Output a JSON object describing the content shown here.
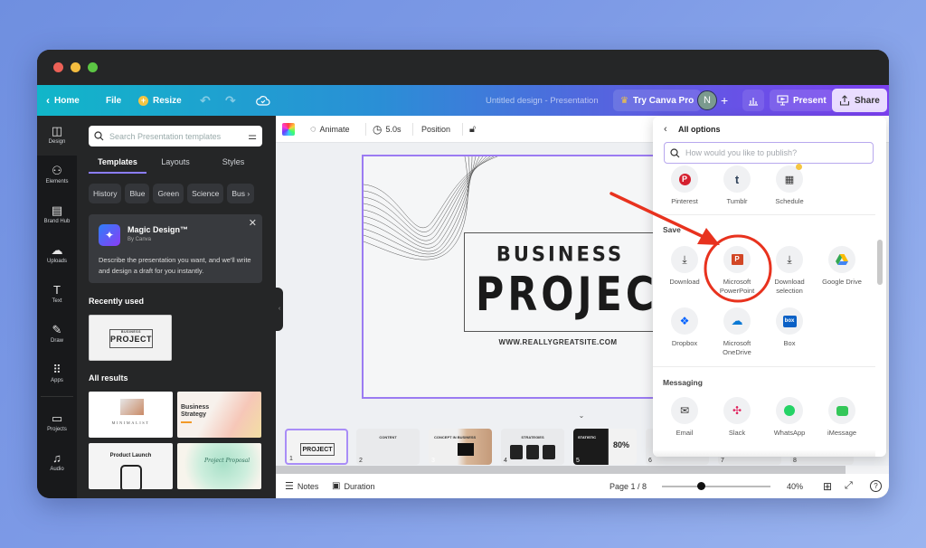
{
  "window": {
    "topbar": {
      "home": "Home",
      "file": "File",
      "resize": "Resize",
      "doc_title": "Untitled design - Presentation",
      "try_pro": "Try Canva Pro",
      "avatar_initial": "N",
      "present": "Present",
      "share": "Share"
    },
    "leftnav": [
      {
        "label": "Design",
        "icon": "layout-icon"
      },
      {
        "label": "Elements",
        "icon": "shapes-icon"
      },
      {
        "label": "Brand Hub",
        "icon": "briefcase-icon"
      },
      {
        "label": "Uploads",
        "icon": "cloud-upload-icon"
      },
      {
        "label": "Text",
        "icon": "text-icon"
      },
      {
        "label": "Draw",
        "icon": "pen-icon"
      },
      {
        "label": "Apps",
        "icon": "grid-icon"
      },
      {
        "label": "Projects",
        "icon": "folder-icon"
      },
      {
        "label": "Audio",
        "icon": "music-icon"
      }
    ],
    "panel": {
      "search_placeholder": "Search Presentation templates",
      "tabs": [
        "Templates",
        "Layouts",
        "Styles"
      ],
      "chips": [
        "History",
        "Blue",
        "Green",
        "Science",
        "Bus"
      ],
      "magic": {
        "title": "Magic Design™",
        "by": "By Canva",
        "desc": "Describe the presentation you want, and we'll write and design a draft for you instantly."
      },
      "recently_used": "Recently used",
      "recent_thumb": {
        "small": "BUSINESS",
        "big": "PROJECT"
      },
      "all_results": "All results",
      "results": [
        {
          "title": "MINIMALIST"
        },
        {
          "title": "Business Strategy"
        },
        {
          "title": "Product Launch"
        },
        {
          "title": "Project Proposal"
        }
      ]
    },
    "toolbar": {
      "animate": "Animate",
      "duration": "5.0s",
      "position": "Position"
    },
    "slide": {
      "line1": "BUSINESS",
      "line2": "PROJECT",
      "url": "WWW.REALLYGREATSITE.COM"
    },
    "pages": [
      {
        "num": "1",
        "title": "BUSINESS",
        "big": "PROJECT"
      },
      {
        "num": "2",
        "title": "CONTENT"
      },
      {
        "num": "3",
        "title": "CONCEPT IN BUSINESS"
      },
      {
        "num": "4",
        "title": "STRATEGIES"
      },
      {
        "num": "5",
        "title": "STATISTIC",
        "big": "80%"
      },
      {
        "num": "6"
      },
      {
        "num": "7"
      },
      {
        "num": "8"
      }
    ],
    "bottombar": {
      "notes": "Notes",
      "duration": "Duration",
      "page": "Page 1 / 8",
      "zoom": "40%",
      "zoom_value": 40
    },
    "share_panel": {
      "title": "All options",
      "search_placeholder": "How would you like to publish?",
      "social": [
        {
          "label": "Pinterest",
          "icon": "pinterest-icon"
        },
        {
          "label": "Tumblr",
          "icon": "tumblr-icon"
        },
        {
          "label": "Schedule",
          "icon": "calendar-icon"
        }
      ],
      "save_heading": "Save",
      "save": [
        {
          "label": "Download",
          "icon": "download-icon"
        },
        {
          "label": "Microsoft PowerPoint",
          "icon": "powerpoint-icon"
        },
        {
          "label": "Download selection",
          "icon": "download-icon"
        },
        {
          "label": "Google Drive",
          "icon": "google-drive-icon"
        },
        {
          "label": "Dropbox",
          "icon": "dropbox-icon"
        },
        {
          "label": "Microsoft OneDrive",
          "icon": "onedrive-icon"
        },
        {
          "label": "Box",
          "icon": "box-icon"
        }
      ],
      "messaging_heading": "Messaging",
      "messaging": [
        {
          "label": "Email",
          "icon": "email-icon"
        },
        {
          "label": "Slack",
          "icon": "slack-icon"
        },
        {
          "label": "WhatsApp",
          "icon": "whatsapp-icon"
        },
        {
          "label": "iMessage",
          "icon": "imessage-icon"
        }
      ]
    },
    "colors": {
      "accent": "#8b7dff",
      "annotation": "#e8321e",
      "share_bg": "#e9dcff"
    }
  }
}
